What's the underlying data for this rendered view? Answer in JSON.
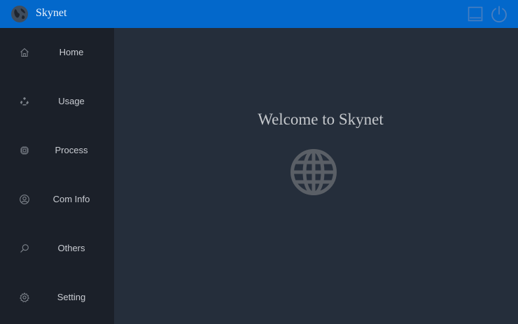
{
  "app": {
    "title": "Skynet",
    "logo_icon": "globe-icon"
  },
  "window_controls": {
    "minimize_icon": "minimize-window-icon",
    "power_icon": "power-icon"
  },
  "sidebar": {
    "items": [
      {
        "label": "Home",
        "icon": "home-icon"
      },
      {
        "label": "Usage",
        "icon": "recycle-icon"
      },
      {
        "label": "Process",
        "icon": "cpu-chip-icon"
      },
      {
        "label": "Com Info",
        "icon": "user-circle-icon"
      },
      {
        "label": "Others",
        "icon": "search-icon"
      },
      {
        "label": "Setting",
        "icon": "gear-icon"
      }
    ]
  },
  "main": {
    "welcome_text": "Welcome to Skynet",
    "hero_icon": "globe-icon"
  },
  "colors": {
    "titlebar": "#0368cb",
    "sidebar": "#1b2029",
    "main_background": "#252e3b",
    "text": "#c9ccd2",
    "globe": "#5a5f66"
  }
}
